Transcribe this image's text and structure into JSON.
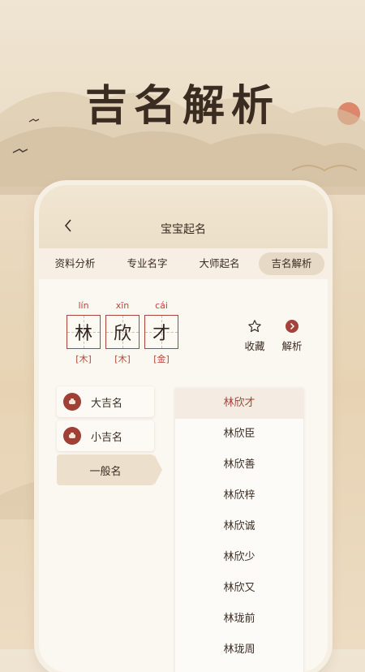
{
  "hero": {
    "title": "吉名解析"
  },
  "app": {
    "title": "宝宝起名",
    "tabs": [
      {
        "label": "资料分析"
      },
      {
        "label": "专业名字"
      },
      {
        "label": "大师起名"
      },
      {
        "label": "吉名解析",
        "active": true
      }
    ],
    "chars": [
      {
        "pinyin": "lín",
        "char": "林",
        "element": "[木]"
      },
      {
        "pinyin": "xīn",
        "char": "欣",
        "element": "[木]"
      },
      {
        "pinyin": "cái",
        "char": "才",
        "element": "[金]"
      }
    ],
    "actions": [
      {
        "label": "收藏",
        "icon": "star-icon"
      },
      {
        "label": "解析",
        "icon": "chevron-right-circle-icon"
      }
    ],
    "categories": [
      {
        "label": "大吉名",
        "icon": "gourd-seal-icon"
      },
      {
        "label": "小吉名",
        "icon": "gourd-seal-icon"
      },
      {
        "label": "一般名",
        "active": true
      }
    ],
    "names": [
      "林欣才",
      "林欣臣",
      "林欣善",
      "林欣梓",
      "林欣诚",
      "林欣少",
      "林欣又",
      "林珑前",
      "林珑周"
    ]
  },
  "colors": {
    "accent": "#a3423a",
    "text": "#3b2c22",
    "background": "#ead9bf"
  }
}
